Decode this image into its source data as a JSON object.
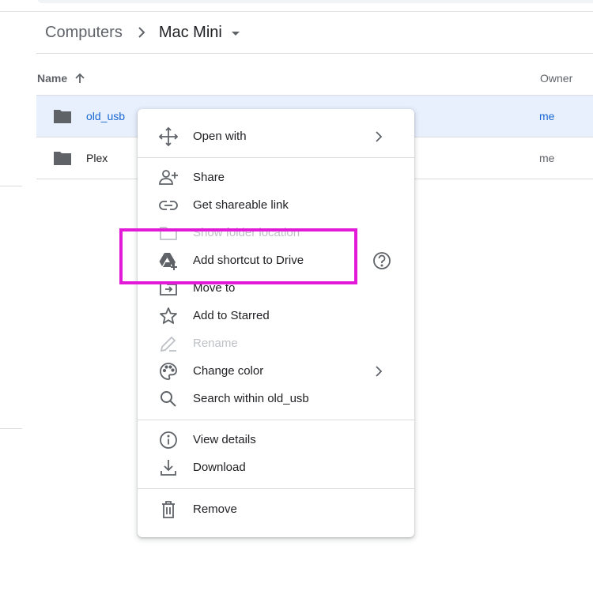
{
  "breadcrumb": {
    "parent": "Computers",
    "current": "Mac Mini"
  },
  "columns": {
    "name": "Name",
    "owner": "Owner"
  },
  "files": [
    {
      "name": "old_usb",
      "owner": "me",
      "selected": true,
      "icon": "folder-icon"
    },
    {
      "name": "Plex",
      "owner": "me",
      "selected": false,
      "icon": "folder-icon"
    }
  ],
  "context_menu": {
    "open_with": "Open with",
    "share": "Share",
    "get_link": "Get shareable link",
    "show_folder_location": "Show folder location",
    "add_shortcut": "Add shortcut to Drive",
    "move_to": "Move to",
    "add_to_starred": "Add to Starred",
    "rename": "Rename",
    "change_color": "Change color",
    "search_within": "Search within old_usb",
    "view_details": "View details",
    "download": "Download",
    "remove": "Remove"
  },
  "colors": {
    "selected_row_bg": "#e8f0fe",
    "selected_text": "#1967d2",
    "highlight_annotation": "#e21ad7",
    "icon_gray": "#5f6368",
    "disabled_text": "#bdc1c6"
  }
}
